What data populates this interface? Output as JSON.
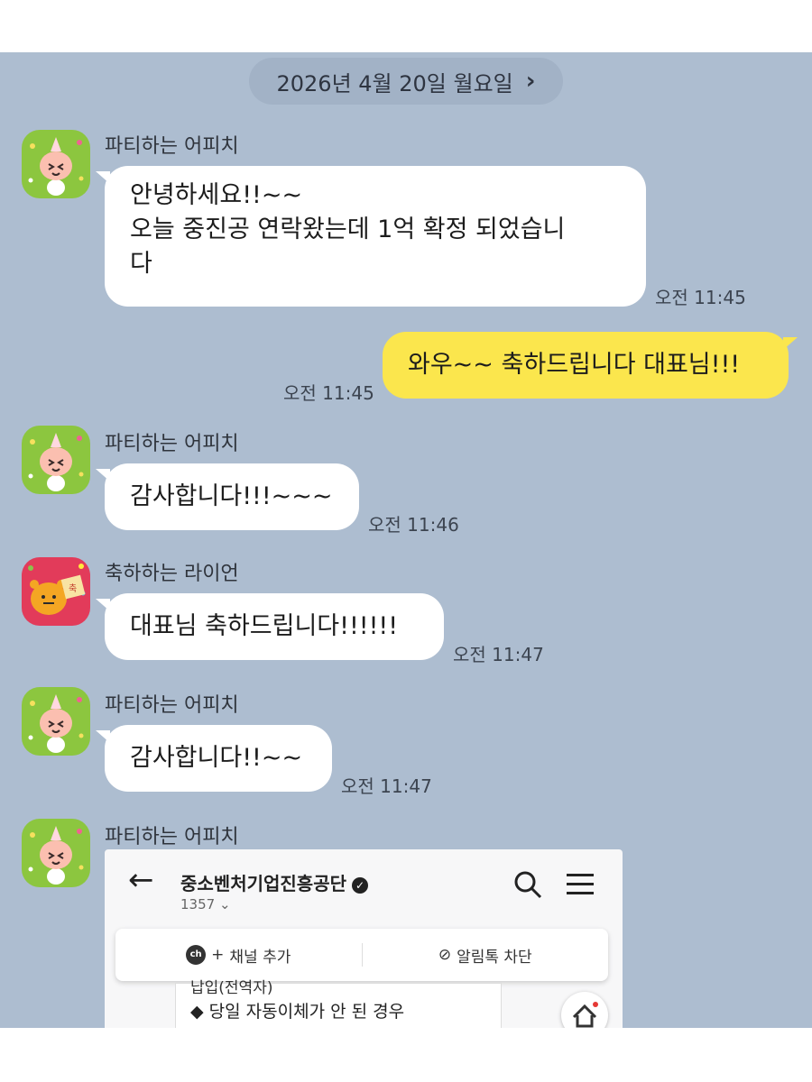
{
  "date_divider": {
    "label": "2026년 4월 20일 월요일",
    "chevron": "›"
  },
  "messages": [
    {
      "sender": "파티하는 어피치",
      "lines": [
        "안녕하세요!!~~",
        "오늘 중진공 연락왔는데 1억 확정 되었습니",
        "다"
      ],
      "time": "오전 11:45"
    },
    {
      "sender": "",
      "mine": true,
      "lines": [
        "와우~~ 축하드립니다 대표님!!!"
      ],
      "time": "오전 11:45"
    },
    {
      "sender": "파티하는 어피치",
      "lines": [
        "감사합니다!!!~~~"
      ],
      "time": "오전 11:46"
    },
    {
      "sender": "축하하는 라이언",
      "lines": [
        "대표님 축하드립니다!!!!!!"
      ],
      "time": "오전 11:47"
    },
    {
      "sender": "파티하는 어피치",
      "lines": [
        "감사합니다!!~~"
      ],
      "time": "오전 11:47"
    },
    {
      "sender": "파티하는 어피치"
    }
  ],
  "screenshot": {
    "title": "중소벤처기업진흥공단",
    "count": "1357",
    "add_channel": "채널 추가",
    "block": "알림톡 차단",
    "card_line": "◆ 당일 자동이체가 안 된 경우",
    "card_cut": "납입(전역자)"
  },
  "colors": {
    "chat_bg": "#adbdd0",
    "mine_bubble": "#fbe64d",
    "other_bubble": "#ffffff"
  }
}
